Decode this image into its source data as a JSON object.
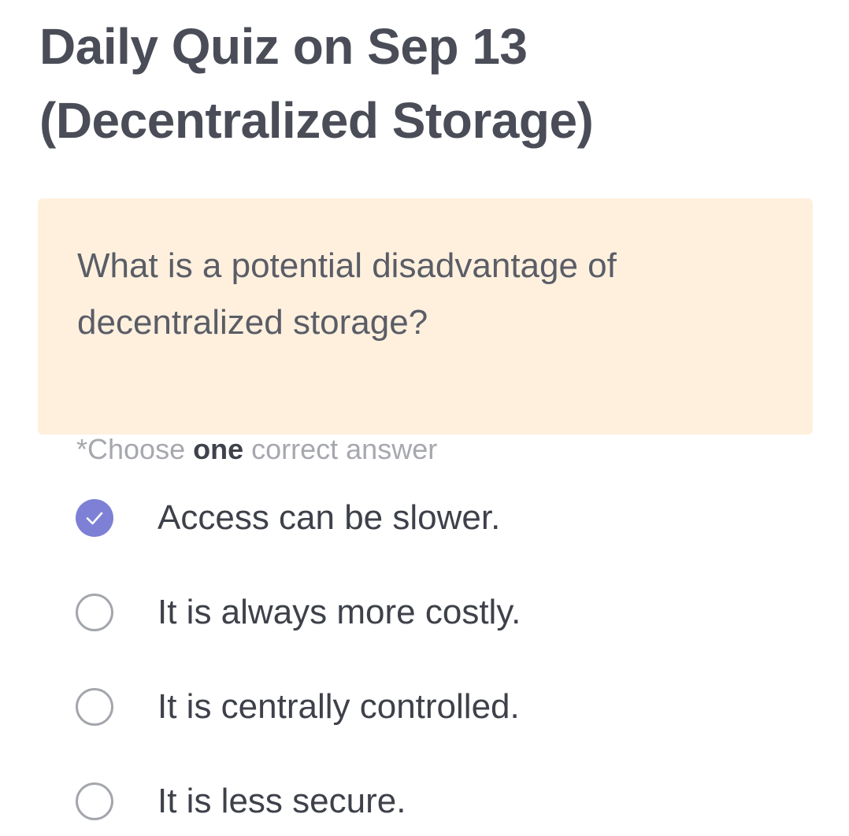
{
  "quiz": {
    "title_line1": "Daily Quiz on Sep 13",
    "title_line2": "(Decentralized Storage)",
    "question_line1": "What is a potential disadvantage of",
    "question_line2": "decentralized storage?",
    "instruction_prefix": "*Choose ",
    "instruction_emphasis": "one",
    "instruction_suffix": " correct answer",
    "options": [
      {
        "label": "Access can be slower.",
        "selected": true
      },
      {
        "label": "It is always more costly.",
        "selected": false
      },
      {
        "label": "It is centrally controlled.",
        "selected": false
      },
      {
        "label": "It is less secure.",
        "selected": false
      }
    ]
  },
  "colors": {
    "accent": "#7d80d4",
    "question_background": "#fff0de",
    "title_text": "#4a4d57",
    "muted_text": "#a6a8ae"
  },
  "icons": {
    "selected_radio": "check-circle-icon",
    "unselected_radio": "radio-empty-icon"
  }
}
